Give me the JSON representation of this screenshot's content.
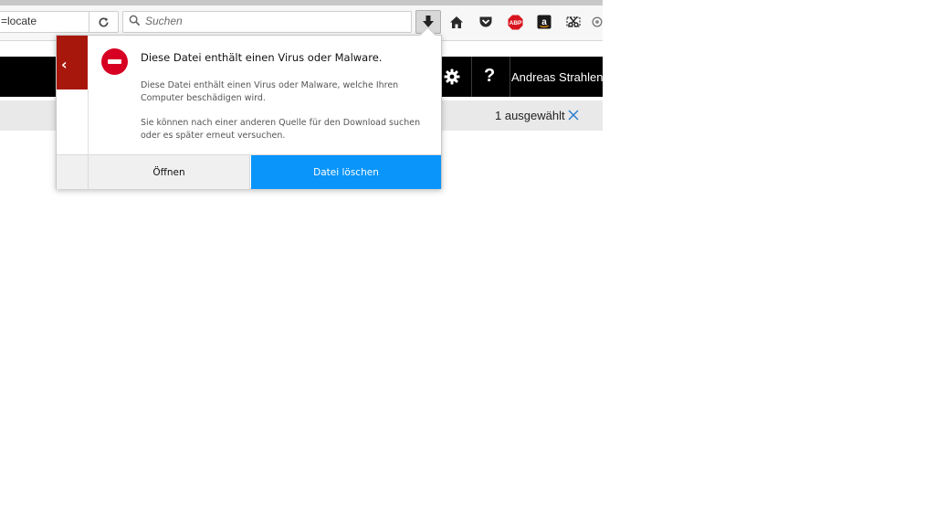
{
  "browser": {
    "url_fragment": "=locate",
    "search_placeholder": "Suchen",
    "toolbar_icons": [
      "reload-icon",
      "search-icon",
      "download-icon",
      "home-icon",
      "pocket-icon",
      "adblock-plus-icon",
      "amazon-icon",
      "screenshot-icon",
      "addon-icon"
    ],
    "adblock_label": "ABP"
  },
  "page": {
    "user_name": "Andreas Strahlend",
    "help_label": "?",
    "selection_status": "1 ausgewählt"
  },
  "download_panel": {
    "title": "Diese Datei enthält einen Virus oder Malware.",
    "message": "Diese Datei enthält einen Virus oder Malware, welche Ihren Computer beschädigen wird.",
    "hint": "Sie können nach einer anderen Quelle für den Download suchen oder es später erneut versuchen.",
    "open_button": "Öffnen",
    "delete_button": "Datei löschen",
    "back_label": "‹"
  },
  "colors": {
    "danger_red": "#d70022",
    "back_strip": "#a8170c",
    "primary_button": "#0a95fb",
    "page_header": "#000000"
  }
}
